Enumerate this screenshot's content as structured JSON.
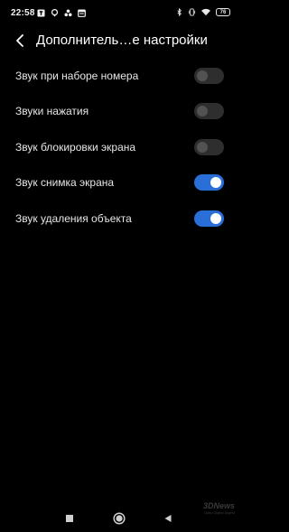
{
  "status_bar": {
    "time": "22:58",
    "battery": "76",
    "left_icons": [
      "notification-app-icon",
      "location-icon",
      "fan-icon",
      "calendar-icon"
    ],
    "right_icons": [
      "bluetooth-icon",
      "vibrate-icon",
      "wifi-icon",
      "battery-icon"
    ]
  },
  "header": {
    "title": "Дополнитель…е настройки",
    "back_icon": "chevron-left-icon"
  },
  "settings": {
    "items": [
      {
        "label": "Звук при наборе номера",
        "enabled": false
      },
      {
        "label": "Звуки нажатия",
        "enabled": false
      },
      {
        "label": "Звук блокировки экрана",
        "enabled": false
      },
      {
        "label": "Звук снимка экрана",
        "enabled": true
      },
      {
        "label": "Звук удаления объекта",
        "enabled": true
      }
    ]
  },
  "nav_bar": {
    "icons": [
      "recents-square-icon",
      "home-circle-icon",
      "back-triangle-icon"
    ]
  },
  "watermark": {
    "logo_text": "3DNews",
    "tagline": "Daily Digital Digest"
  },
  "colors": {
    "background": "#000000",
    "accent": "#2a6fd8",
    "toggle_off_track": "#2e2e2e",
    "toggle_off_knob": "#525252",
    "text": "#e6e6e6"
  }
}
